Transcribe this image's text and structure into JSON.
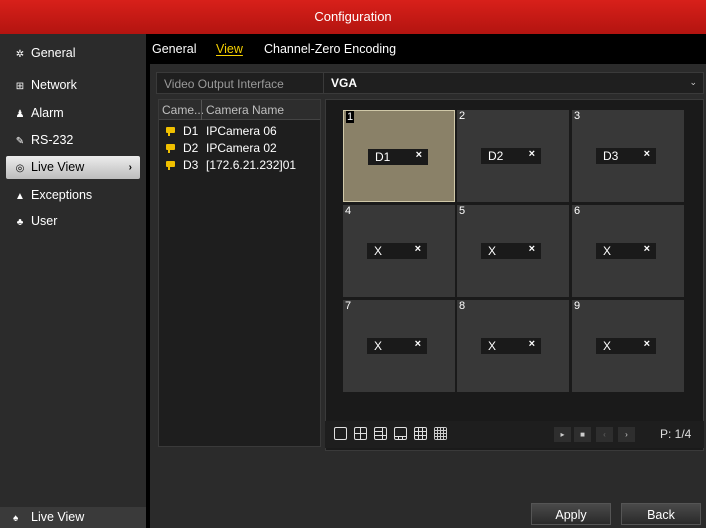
{
  "window": {
    "title": "Configuration"
  },
  "sidebar": {
    "items": [
      {
        "label": "General",
        "icon": "gear-icon",
        "glyph": "✲"
      },
      {
        "label": "Network",
        "icon": "network-icon",
        "glyph": "⊞"
      },
      {
        "label": "Alarm",
        "icon": "alarm-icon",
        "glyph": "♟"
      },
      {
        "label": "RS-232",
        "icon": "rs232-icon",
        "glyph": "✎"
      },
      {
        "label": "Live View",
        "icon": "eye-icon",
        "glyph": "◎",
        "active": true
      },
      {
        "label": "Exceptions",
        "icon": "warning-icon",
        "glyph": "▲"
      },
      {
        "label": "User",
        "icon": "users-icon",
        "glyph": "♣"
      }
    ],
    "footer": {
      "label": "Live View",
      "icon": "home-icon",
      "glyph": "♠"
    }
  },
  "tabs": [
    {
      "label": "General"
    },
    {
      "label": "View",
      "active": true
    },
    {
      "label": "Channel-Zero Encoding"
    }
  ],
  "video_output": {
    "label": "Video Output Interface",
    "value": "VGA"
  },
  "camera_list": {
    "headers": [
      "Came...",
      "Camera Name"
    ],
    "rows": [
      {
        "id": "D1",
        "name": "IPCamera 06"
      },
      {
        "id": "D2",
        "name": "IPCamera 02"
      },
      {
        "id": "D3",
        "name": "[172.6.21.232]01"
      }
    ]
  },
  "grid": {
    "cells": [
      {
        "num": "1",
        "label": "D1",
        "close": "×",
        "selected": true
      },
      {
        "num": "2",
        "label": "D2",
        "close": "×"
      },
      {
        "num": "3",
        "label": "D3",
        "close": "×"
      },
      {
        "num": "4",
        "label": "X",
        "close": "×"
      },
      {
        "num": "5",
        "label": "X",
        "close": "×"
      },
      {
        "num": "6",
        "label": "X",
        "close": "×"
      },
      {
        "num": "7",
        "label": "X",
        "close": "×"
      },
      {
        "num": "8",
        "label": "X",
        "close": "×"
      },
      {
        "num": "9",
        "label": "X",
        "close": "×"
      }
    ]
  },
  "toolbar": {
    "page_indicator": "P: 1/4",
    "play_glyph": "▸",
    "stop_glyph": "■",
    "prev_glyph": "‹",
    "next_glyph": "›"
  },
  "buttons": {
    "apply": "Apply",
    "back": "Back"
  },
  "colors": {
    "title_red": "#c8181a",
    "active_tab": "#f5d000",
    "camera_icon": "#f0c000"
  }
}
